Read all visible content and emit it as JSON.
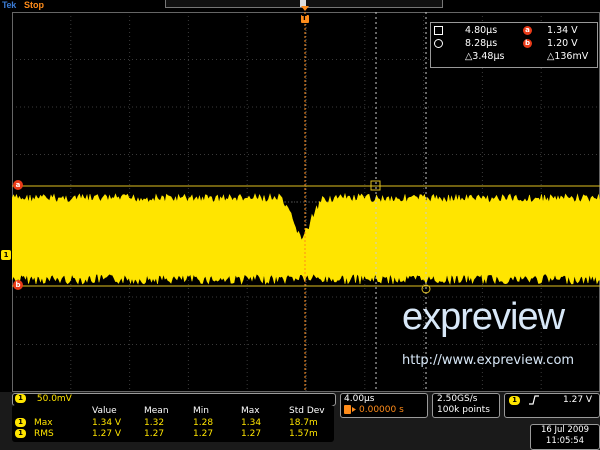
{
  "header": {
    "brand": "Tek",
    "status": "Stop"
  },
  "colors": {
    "ch1": "#ffe500",
    "cursor_badge": "#e83a18",
    "status": "#ff8c1a",
    "brand": "#3a7bd5"
  },
  "trigger_marker": {
    "icon": "trigger-position-icon",
    "label": "T"
  },
  "markers": {
    "a": "a",
    "b": "b",
    "ch1": "1"
  },
  "cursor_readout": {
    "row1": {
      "time": "4.80µs",
      "badge": "a",
      "volt": "1.34 V"
    },
    "row2": {
      "time": "8.28µs",
      "badge": "b",
      "volt": "1.20 V"
    },
    "row3": {
      "dtime": "△3.48µs",
      "dvolt": "△136mV"
    }
  },
  "watermark": {
    "logo": "expreview",
    "url": "http://www.expreview.com"
  },
  "channel": {
    "label": "1",
    "scale": "50.0mV"
  },
  "measurements": {
    "headers": [
      "Value",
      "Mean",
      "Min",
      "Max",
      "Std Dev"
    ],
    "rows": [
      {
        "channel": "1",
        "name": "Max",
        "values": [
          "1.34 V",
          "1.32",
          "1.28",
          "1.34",
          "18.7m"
        ]
      },
      {
        "channel": "1",
        "name": "RMS",
        "values": [
          "1.27 V",
          "1.27",
          "1.27",
          "1.27",
          "1.57m"
        ]
      }
    ]
  },
  "timebase": {
    "scale": "4.00µs",
    "delay_icon": "trigger-delay-icon",
    "delay": "0.00000 s"
  },
  "acquisition": {
    "rate": "2.50GS/s",
    "record": "100k points"
  },
  "trigger": {
    "channel": "1",
    "slope_icon": "rising-edge-icon",
    "level": "1.27 V"
  },
  "datetime": {
    "date": "16 Jul 2009",
    "time": "11:05:54"
  }
}
